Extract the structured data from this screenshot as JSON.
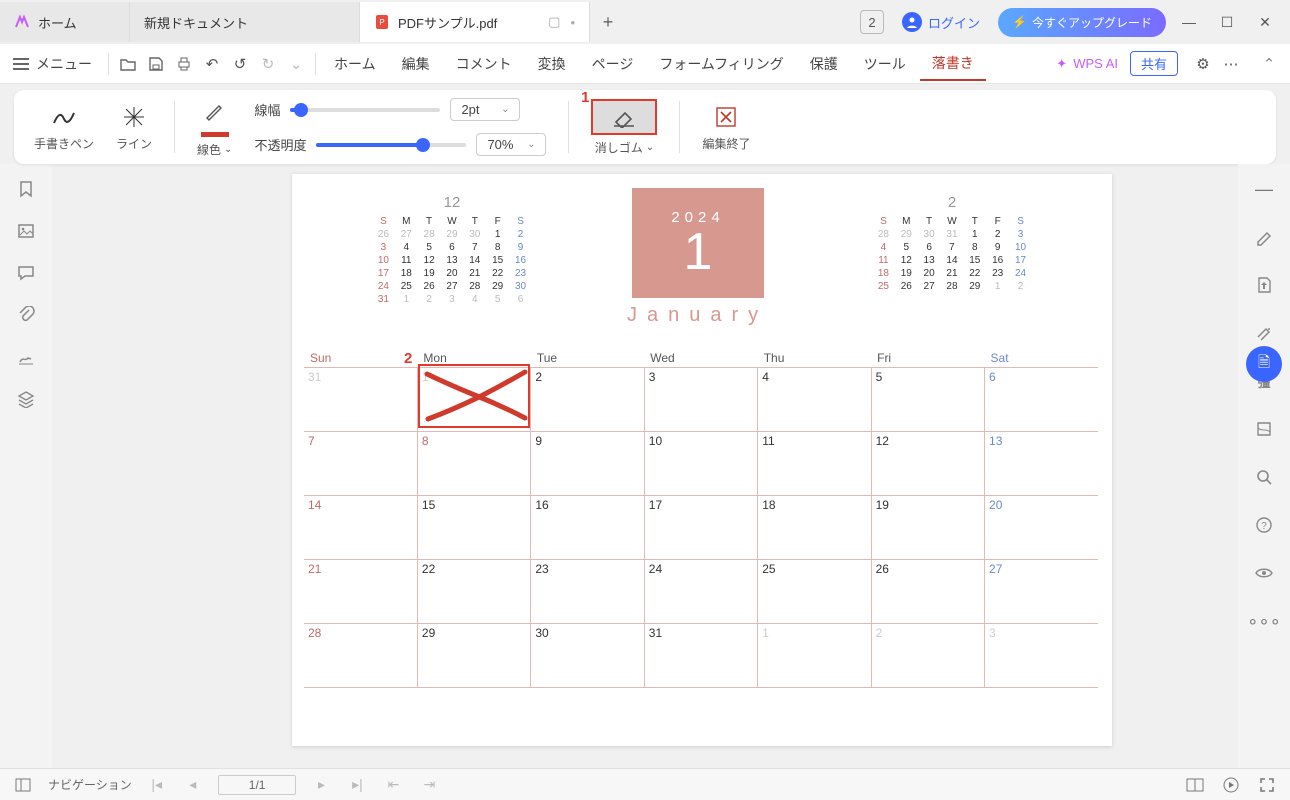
{
  "tabs": {
    "home": "ホーム",
    "doc": "新規ドキュメント",
    "pdf": "PDFサンプル.pdf"
  },
  "title_right": {
    "num": "2",
    "login": "ログイン",
    "upgrade": "今すぐアップグレード"
  },
  "menu": {
    "menu_label": "メニュー",
    "items": [
      "ホーム",
      "編集",
      "コメント",
      "変換",
      "ページ",
      "フォームフィリング",
      "保護",
      "ツール",
      "落書き"
    ],
    "active_index": 8,
    "wpsai": "WPS AI",
    "share": "共有"
  },
  "subtoolbar": {
    "pen": "手書きペン",
    "line": "ライン",
    "color": "線色",
    "width_label": "線幅",
    "width_value": "2pt",
    "opacity_label": "不透明度",
    "opacity_value": "70%",
    "eraser": "消しゴム",
    "exit": "編集終了"
  },
  "annotations": {
    "mark1": "1",
    "mark2": "2"
  },
  "calendar": {
    "year": "2024",
    "month_num": "1",
    "month_name": "January",
    "prev_title": "12",
    "next_title": "2",
    "grid_headers": [
      "Sun",
      "Mon",
      "Tue",
      "Wed",
      "Thu",
      "Fri",
      "Sat"
    ],
    "rows": [
      [
        "31",
        "1",
        "2",
        "3",
        "4",
        "5",
        "6"
      ],
      [
        "7",
        "8",
        "9",
        "10",
        "11",
        "12",
        "13"
      ],
      [
        "14",
        "15",
        "16",
        "17",
        "18",
        "19",
        "20"
      ],
      [
        "21",
        "22",
        "23",
        "24",
        "25",
        "26",
        "27"
      ],
      [
        "28",
        "29",
        "30",
        "31",
        "1",
        "2",
        "3"
      ]
    ]
  },
  "status": {
    "nav": "ナビゲーション",
    "page": "1/1"
  },
  "chart_data": {
    "type": "table",
    "title": "January 2024 calendar grid",
    "columns": [
      "Sun",
      "Mon",
      "Tue",
      "Wed",
      "Thu",
      "Fri",
      "Sat"
    ],
    "rows": [
      [
        "31",
        "1",
        "2",
        "3",
        "4",
        "5",
        "6"
      ],
      [
        "7",
        "8",
        "9",
        "10",
        "11",
        "12",
        "13"
      ],
      [
        "14",
        "15",
        "16",
        "17",
        "18",
        "19",
        "20"
      ],
      [
        "21",
        "22",
        "23",
        "24",
        "25",
        "26",
        "27"
      ],
      [
        "28",
        "29",
        "30",
        "31",
        "1",
        "2",
        "3"
      ]
    ]
  }
}
